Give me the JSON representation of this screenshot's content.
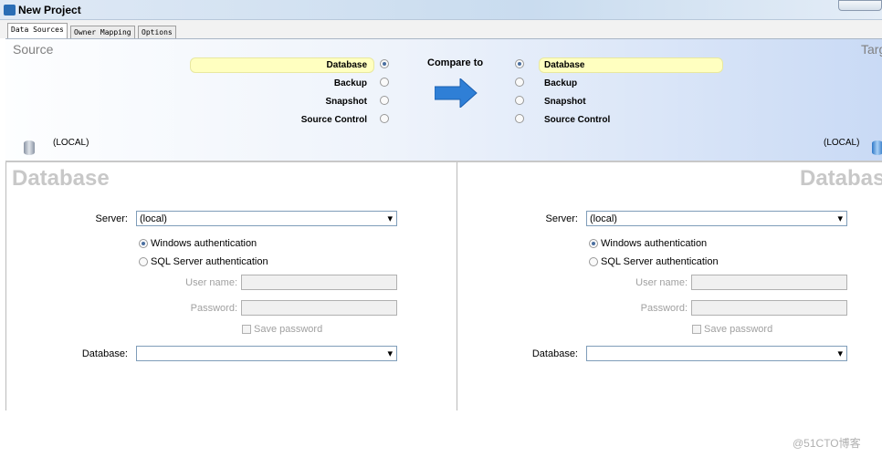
{
  "window": {
    "title": "New Project"
  },
  "tabs": [
    "Data Sources",
    "Owner Mapping",
    "Options"
  ],
  "header": {
    "source_title": "Source",
    "target_title": "Target",
    "compare_to": "Compare to",
    "options": [
      "Database",
      "Backup",
      "Snapshot",
      "Source Control"
    ],
    "source_selected": "Database",
    "target_selected": "Database",
    "source_server": "(LOCAL)",
    "target_server": "(LOCAL)"
  },
  "form": {
    "title": "Database",
    "server_label": "Server:",
    "server_value": "(local)",
    "windows_auth": "Windows authentication",
    "sql_auth": "SQL Server authentication",
    "user_label": "User name:",
    "password_label": "Password:",
    "save_password": "Save password",
    "database_label": "Database:",
    "database_value": ""
  },
  "watermark": "@51CTO博客"
}
